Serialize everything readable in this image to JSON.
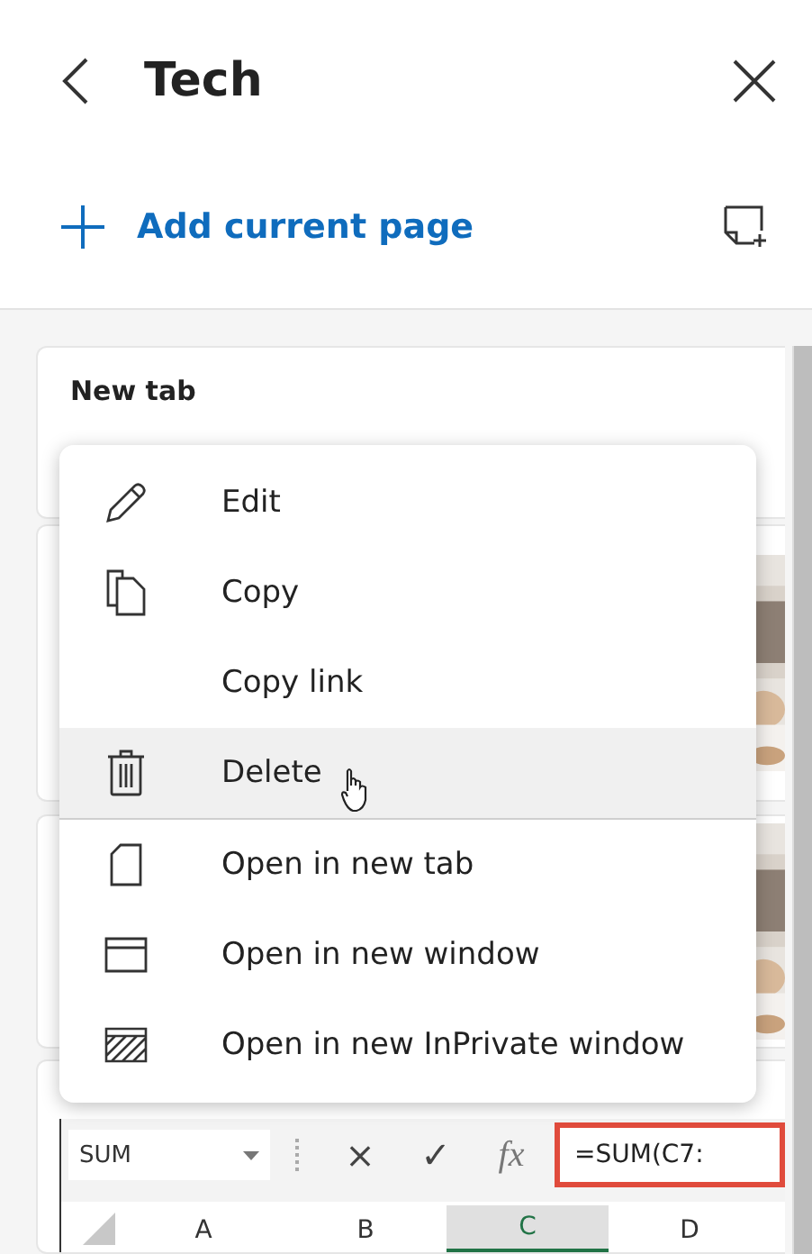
{
  "header": {
    "title": "Tech"
  },
  "add_button": {
    "label": "Add current page"
  },
  "cards": [
    {
      "kind": "note",
      "title": "New tab"
    },
    {
      "kind": "picture"
    },
    {
      "kind": "picture"
    },
    {
      "kind": "sheet",
      "name_box": "SUM",
      "cancel": "×",
      "enter": "✓",
      "fx": "fx",
      "formula": "=SUM(C7:",
      "columns": [
        {
          "label": "A",
          "selected": false
        },
        {
          "label": "B",
          "selected": false
        },
        {
          "label": "C",
          "selected": true
        },
        {
          "label": "D",
          "selected": false
        }
      ]
    }
  ],
  "menu": {
    "sections": [
      {
        "items": [
          {
            "label": "Edit",
            "kind": "pencil",
            "hovered": false
          },
          {
            "label": "Copy",
            "kind": "copy",
            "hovered": false
          },
          {
            "label": "Copy link",
            "kind": "plain",
            "hovered": false
          },
          {
            "label": "Delete",
            "kind": "trash",
            "hovered": true
          }
        ]
      },
      {
        "items": [
          {
            "label": "Open in new tab",
            "kind": "page",
            "hovered": false
          },
          {
            "label": "Open in new window",
            "kind": "window",
            "hovered": false
          },
          {
            "label": "Open in new InPrivate window",
            "kind": "hatched",
            "hovered": false
          }
        ]
      }
    ]
  }
}
